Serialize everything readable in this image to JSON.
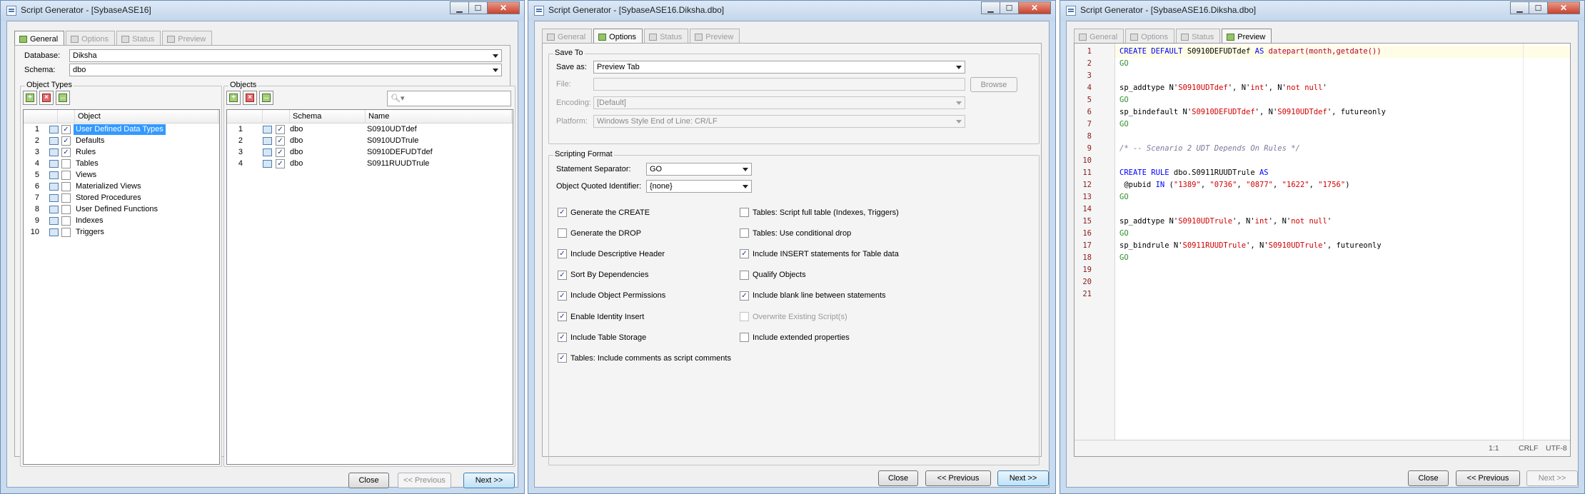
{
  "colors": {
    "accent": "#3399ff",
    "keyword": "#0000ff",
    "string": "#d10000",
    "go": "#2f8f2f",
    "comment": "#7a7a9a"
  },
  "windows": [
    {
      "title": "Script Generator - [SybaseASE16]"
    },
    {
      "title": "Script Generator - [SybaseASE16.Diksha.dbo]"
    },
    {
      "title": "Script Generator - [SybaseASE16.Diksha.dbo]"
    }
  ],
  "tabs": [
    "General",
    "Options",
    "Status",
    "Preview"
  ],
  "general": {
    "database_label": "Database:",
    "database_value": "Diksha",
    "schema_label": "Schema:",
    "schema_value": "dbo",
    "object_types": {
      "title": "Object Types",
      "column_header": "Object",
      "rows": [
        {
          "num": "1",
          "label": "User Defined Data Types",
          "checked": "✓"
        },
        {
          "num": "2",
          "label": "Defaults",
          "checked": "✓"
        },
        {
          "num": "3",
          "label": "Rules",
          "checked": "✓"
        },
        {
          "num": "4",
          "label": "Tables",
          "checked": ""
        },
        {
          "num": "5",
          "label": "Views",
          "checked": ""
        },
        {
          "num": "6",
          "label": "Materialized Views",
          "checked": ""
        },
        {
          "num": "7",
          "label": "Stored Procedures",
          "checked": ""
        },
        {
          "num": "8",
          "label": "User Defined Functions",
          "checked": ""
        },
        {
          "num": "9",
          "label": "Indexes",
          "checked": ""
        },
        {
          "num": "10",
          "label": "Triggers",
          "checked": ""
        }
      ]
    },
    "objects": {
      "title": "Objects",
      "col_schema": "Schema",
      "col_name": "Name",
      "rows": [
        {
          "num": "1",
          "schema": "dbo",
          "name": "S0910UDTdef",
          "checked": "✓"
        },
        {
          "num": "2",
          "schema": "dbo",
          "name": "S0910UDTrule",
          "checked": "✓"
        },
        {
          "num": "3",
          "schema": "dbo",
          "name": "S0910DEFUDTdef",
          "checked": "✓"
        },
        {
          "num": "4",
          "schema": "dbo",
          "name": "S0911RUUDTrule",
          "checked": "✓"
        }
      ]
    }
  },
  "options": {
    "save_to": {
      "title": "Save To",
      "save_as_label": "Save as:",
      "save_as_value": "Preview Tab",
      "file_label": "File:",
      "browse_label": "Browse",
      "encoding_label": "Encoding:",
      "encoding_value": "[Default]",
      "platform_label": "Platform:",
      "platform_value": "Windows Style End of Line: CR/LF"
    },
    "scripting_format": {
      "title": "Scripting Format",
      "separator_label": "Statement Separator:",
      "separator_value": "GO",
      "quoted_label": "Object Quoted Identifier:",
      "quoted_value": "{none}",
      "left": [
        {
          "label": "Generate the CREATE",
          "checked": "✓"
        },
        {
          "label": "Generate the DROP",
          "checked": ""
        },
        {
          "label": "Include Descriptive Header",
          "checked": "✓"
        },
        {
          "label": "Sort By Dependencies",
          "checked": "✓"
        },
        {
          "label": "Include Object Permissions",
          "checked": "✓"
        },
        {
          "label": "Enable Identity Insert",
          "checked": "✓"
        },
        {
          "label": "Include Table Storage",
          "checked": "✓"
        },
        {
          "label": "Tables: Include comments as script comments",
          "checked": "✓"
        }
      ],
      "right": [
        {
          "label": "Tables: Script full table (Indexes, Triggers)",
          "checked": ""
        },
        {
          "label": "Tables: Use conditional drop",
          "checked": ""
        },
        {
          "label": "Include INSERT statements for Table data",
          "checked": "✓"
        },
        {
          "label": "Qualify Objects",
          "checked": ""
        },
        {
          "label": "Include blank line between statements",
          "checked": "✓"
        },
        {
          "label": "Overwrite Existing Script(s)",
          "checked": ""
        },
        {
          "label": "Include extended properties",
          "checked": ""
        }
      ]
    }
  },
  "preview": {
    "line_numbers": [
      "1",
      "2",
      "3",
      "4",
      "5",
      "6",
      "7",
      "8",
      "9",
      "10",
      "11",
      "12",
      "13",
      "14",
      "15",
      "16",
      "17",
      "18",
      "19",
      "20",
      "21"
    ],
    "code": {
      "l1": {
        "a": "CREATE DEFAULT",
        "b": " S0910DEFUDTdef ",
        "c": "AS",
        "d": " datepart",
        "e": "(month,getdate())"
      },
      "l2": "GO",
      "l4": {
        "a": "sp_addtype N'",
        "b": "S0910UDTdef",
        "c": "', N'",
        "d": "int",
        "e": "', N'",
        "f": "not null",
        "g": "'"
      },
      "l5": "GO",
      "l6": {
        "a": "sp_bindefault N'",
        "b": "S0910DEFUDTdef",
        "c": "', N'",
        "d": "S0910UDTdef",
        "e": "', futureonly"
      },
      "l7": "GO",
      "l9": "/* -- Scenario 2 UDT Depends On Rules */",
      "l11": {
        "a": "CREATE RULE",
        "b": " dbo.S0911RUUDTrule ",
        "c": "AS"
      },
      "l12": {
        "a": " @pubid ",
        "b": "IN",
        "c": " (",
        "d": "\"1389\"",
        "e": ", ",
        "f": "\"0736\"",
        "g": ", ",
        "h": "\"0877\"",
        "i": ", ",
        "j": "\"1622\"",
        "k": ", ",
        "l": "\"1756\"",
        "m": ")"
      },
      "l13": "GO",
      "l15": {
        "a": "sp_addtype N'",
        "b": "S0910UDTrule",
        "c": "', N'",
        "d": "int",
        "e": "', N'",
        "f": "not null",
        "g": "'"
      },
      "l16": "GO",
      "l17": {
        "a": "sp_bindrule N'",
        "b": "S0911RUUDTrule",
        "c": "', N'",
        "d": "S0910UDTrule",
        "e": "', futureonly"
      },
      "l18": "GO"
    },
    "status": {
      "position": "1:1",
      "eol": "CRLF",
      "encoding": "UTF-8"
    }
  },
  "buttons": {
    "close": "Close",
    "previous": "<< Previous",
    "next": "Next >>"
  }
}
